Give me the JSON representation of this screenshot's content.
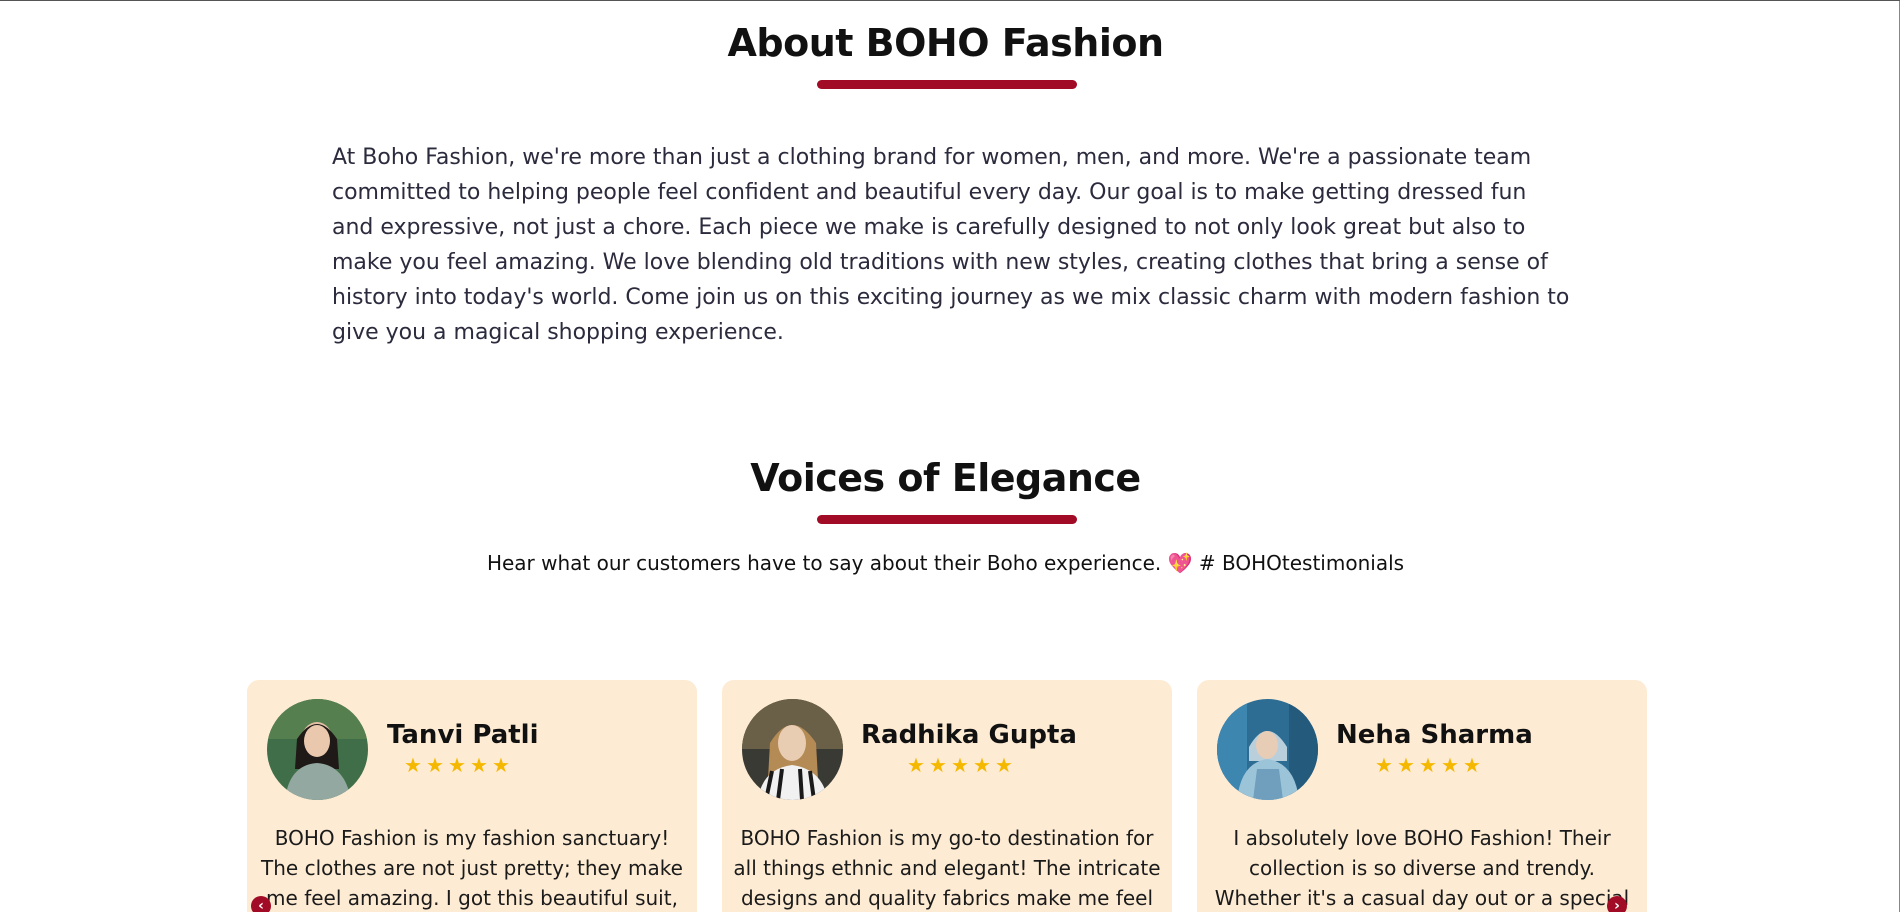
{
  "about": {
    "title": "About BOHO Fashion",
    "text": "At Boho Fashion, we're more than just a clothing brand for women, men, and more. We're a passionate team committed to helping people feel confident and beautiful every day. Our goal is to make getting dressed fun and expressive, not just a chore. Each piece we make is carefully designed to not only look great but also to make you feel amazing. We love blending old traditions with new styles, creating clothes that bring a sense of history into today's world. Come join us on this exciting journey as we mix classic charm with modern fashion to give you a magical shopping experience."
  },
  "testimonials": {
    "title": "Voices of Elegance",
    "subtitle_prefix": "Hear what our customers have to say about their Boho experience.",
    "subtitle_heart": "💖",
    "subtitle_hashtag": "# BOHOtestimonials",
    "prev_arrow": "‹",
    "next_arrow": "›",
    "cards": [
      {
        "name": "Tanvi Patli",
        "rating": 5,
        "star": "★",
        "review": "BOHO Fashion is my fashion sanctuary! The clothes are not just pretty; they make me feel amazing. I got this beautiful suit,",
        "avatar_colors": [
          "#3f6e48",
          "#93a8a0"
        ]
      },
      {
        "name": "Radhika Gupta",
        "rating": 5,
        "star": "★",
        "review": "BOHO Fashion is my go-to destination for all things ethnic and elegant! The intricate designs and quality fabrics make me feel",
        "avatar_colors": [
          "#3a3a34",
          "#c9b18c"
        ]
      },
      {
        "name": "Neha Sharma",
        "rating": 5,
        "star": "★",
        "review": "I absolutely love BOHO Fashion! Their collection is so diverse and trendy. Whether it's a casual day out or a special",
        "avatar_colors": [
          "#2d6c93",
          "#9cc4d9"
        ]
      }
    ]
  },
  "colors": {
    "accent": "#a10b26",
    "card_bg": "#fdebd3",
    "star": "#f5b800"
  }
}
